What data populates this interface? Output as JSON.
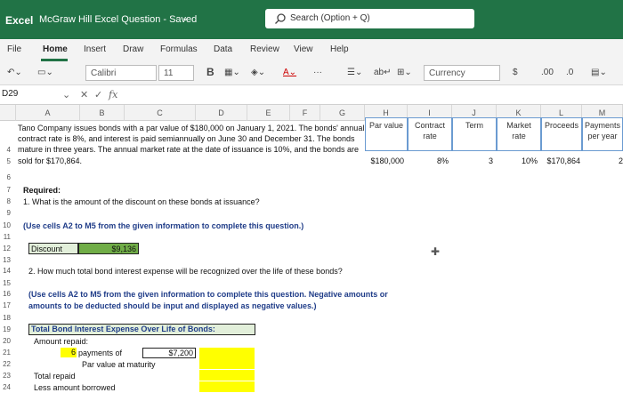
{
  "titlebar": {
    "app": "Excel",
    "doc_title": "McGraw Hill Excel Question - Saved",
    "search_placeholder": "Search (Option + Q)"
  },
  "tabs": [
    "File",
    "Home",
    "Insert",
    "Draw",
    "Formulas",
    "Data",
    "Review",
    "View",
    "Help"
  ],
  "toolbar": {
    "font": "Calibri",
    "size": "11",
    "bold": "B",
    "number_format": "Currency",
    "dollar": "$",
    "inc_decimal": ".00",
    "dec_decimal": ".0"
  },
  "formula_bar": {
    "name_box": "D29",
    "cancel": "✕",
    "enter": "✓",
    "fx": "fx"
  },
  "columns": [
    "A",
    "B",
    "C",
    "D",
    "E",
    "F",
    "G",
    "H",
    "I",
    "J",
    "K",
    "L",
    "M"
  ],
  "rows": [
    "4",
    "5",
    "6",
    "7",
    "8",
    "9",
    "10",
    "11",
    "12",
    "13",
    "14",
    "15",
    "16",
    "17",
    "18",
    "19",
    "20",
    "21",
    "22",
    "23",
    "24"
  ],
  "problem_text": [
    "Tano Company issues bonds with a par value of $180,000 on January 1, 2021. The bonds' annual",
    "contract rate is 8%, and interest is paid semiannually on June 30 and December 31. The bonds",
    "mature in three years. The annual market rate at the date of issuance is 10%, and the bonds are",
    "sold for $170,864."
  ],
  "headers": {
    "par_value": "Par value",
    "contract_rate_1": "Contract",
    "contract_rate_2": "rate",
    "term": "Term",
    "market_rate_1": "Market",
    "market_rate_2": "rate",
    "proceeds": "Proceeds",
    "payments_1": "Payments",
    "payments_2": "per year"
  },
  "values": {
    "par_value": "$180,000",
    "contract_rate": "8%",
    "term": "3",
    "market_rate": "10%",
    "proceeds": "$170,864",
    "payments": "2"
  },
  "body": {
    "required": "Required:",
    "q1": "1. What is the amount of the discount on these bonds at issuance?",
    "note1": "(Use cells A2 to M5 from the given information to complete this question.)",
    "discount_label": "Discount",
    "discount_value": "$9,136",
    "q2": "2. How much total bond interest expense will be recognized over the life of these bonds?",
    "note2a": "(Use cells A2 to M5 from the given information to complete this question. Negative amounts or",
    "note2b": "amounts to be deducted should be input and displayed as negative values.)",
    "table_title": "Total Bond Interest Expense Over Life of Bonds:",
    "amount_repaid": "Amount repaid:",
    "payments_count": "6",
    "payments_of": "payments of",
    "payment_value": "$7,200",
    "par_at_maturity": "Par value at maturity",
    "total_repaid": "Total repaid",
    "less_borrowed": "Less amount borrowed"
  }
}
